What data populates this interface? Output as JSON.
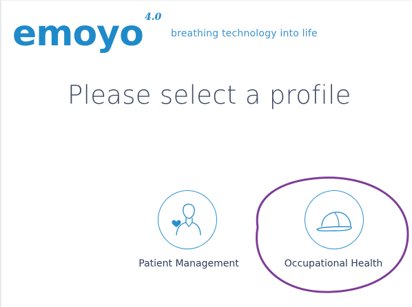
{
  "header": {
    "logo_text": "emoyo",
    "logo_version": "4.0",
    "tagline": "breathing technology into life"
  },
  "main": {
    "heading": "Please select a profile",
    "profiles": [
      {
        "id": "patient-management",
        "label": "Patient Management",
        "icon": "person-with-heart-icon"
      },
      {
        "id": "occupational-health",
        "label": "Occupational Health",
        "icon": "hard-hat-icon"
      }
    ]
  },
  "colors": {
    "brand_blue": "#1f8ac9",
    "icon_blue": "#2b8fcc",
    "heading_text": "#3e4a66",
    "highlight_purple": "#7d3c98"
  }
}
